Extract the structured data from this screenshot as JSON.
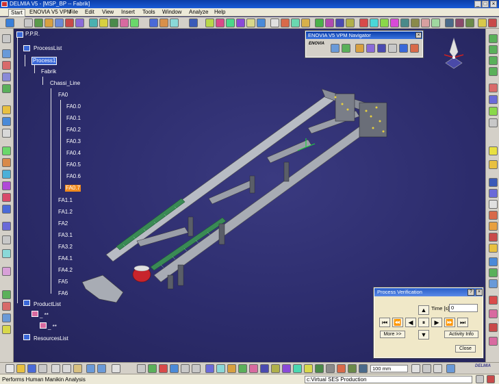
{
  "window": {
    "title": "DELMIA V5 - [MSP_BP -- Fabrik]"
  },
  "menu": {
    "items": [
      "Start",
      "ENOVIA V5 VPM",
      "File",
      "Edit",
      "View",
      "Insert",
      "Tools",
      "Window",
      "Analyze",
      "Help"
    ]
  },
  "tree": {
    "ppr": "P.P.R.",
    "process_list": "ProcessList",
    "process1": "Process1",
    "fabrik": "Fabrik",
    "chassi_line": "Chassi_Line",
    "fa_nodes": [
      "FA0",
      "FA0.0",
      "FA0.1",
      "FA0.2",
      "FA0.3",
      "FA0.4",
      "FA0.5",
      "FA0.6",
      "FA0.7",
      "FA1.1",
      "FA1.2",
      "FA2",
      "FA3.1",
      "FA3.2",
      "FA4.1",
      "FA4.2",
      "FA5",
      "FA6"
    ],
    "product_list": "ProductList",
    "product_child_1": "_ **",
    "product_child_2": "_ **",
    "resources_list": "ResourcesList",
    "selected_process": "Process1",
    "selected_node": "FA0.7"
  },
  "navigator": {
    "title": "ENOVIA V5 VPM Navigator",
    "logo": "ENOVIA"
  },
  "process_verification": {
    "title": "Process Verification",
    "help": "?",
    "close_x": "×",
    "time_label": "Time [s]",
    "time_value": "0",
    "more_button": "More >>",
    "activity_info_button": "Activity Info",
    "close_button": "Close"
  },
  "bottom_toolbar": {
    "zoom_value": "100 mm",
    "delmia_logo": "DELMIA"
  },
  "status": {
    "message": "Performs Human Manikin Analysis",
    "command_value": "c:Virtual SES Production"
  },
  "colors": {
    "viewport_bg": "#2c2c6c",
    "title_bg": "#0b3ea8",
    "selection_orange": "#f08a1e",
    "selection_blue": "#3a68d8",
    "chassis": "#b8bcc4",
    "conveyor": "#3a8a55",
    "tank": "#c8242c"
  }
}
